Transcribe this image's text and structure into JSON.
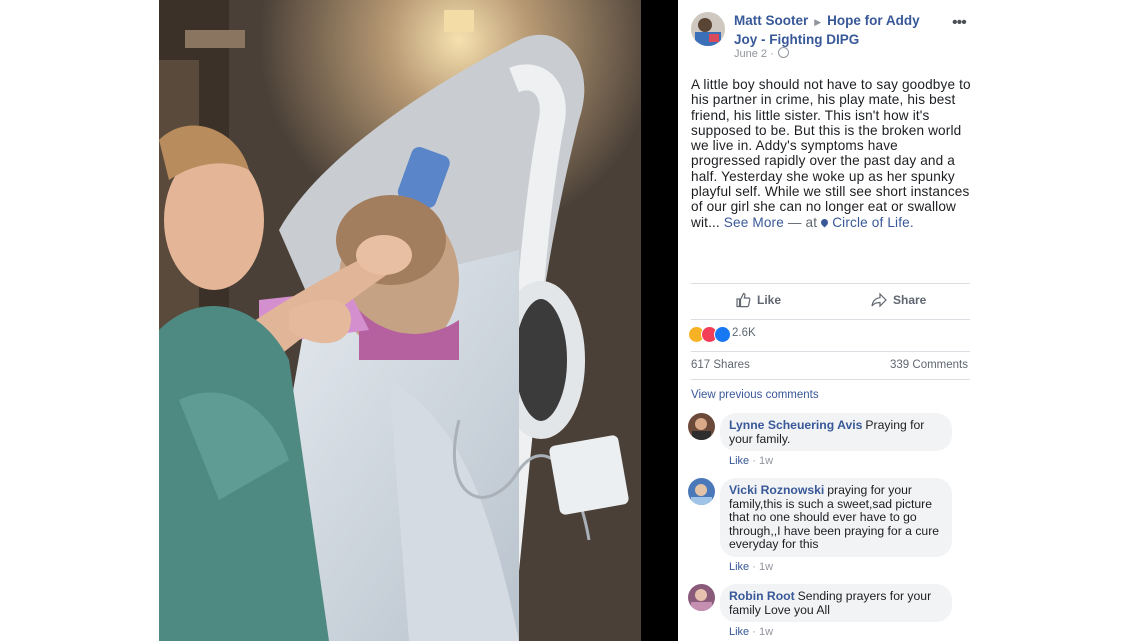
{
  "post": {
    "author": "Matt Sooter",
    "group": "Hope for Addy Joy - Fighting DIPG",
    "date": "June 2",
    "text": "A little boy should not have to say goodbye to his partner in crime, his play mate, his best friend, his little sister. This isn't how it's supposed to be. But this is the broken world we live in. Addy's symptoms have progressed rapidly over the past day and a half. Yesterday she woke up as her spunky playful self. While we still see short instances of our girl she can no longer eat or swallow wit...",
    "see_more": "See More",
    "at_separator": "— at",
    "place": "Circle of Life."
  },
  "actions": {
    "like_label": "Like",
    "share_label": "Share"
  },
  "stats": {
    "reactions": "2.6K",
    "reaction_icons": [
      "sad-icon",
      "love-icon",
      "like-icon"
    ],
    "shares": "617 Shares",
    "comments": "339 Comments"
  },
  "view_previous": "View previous comments",
  "comments": [
    {
      "name": "Lynne Scheuering Avis",
      "text": "Praying for your family.",
      "like": "Like",
      "time": "1w"
    },
    {
      "name": "Vicki Roznowski",
      "text": "praying for your family,this is such a sweet,sad picture that no one should ever have to go through,,I have been praying for a cure everyday for this",
      "like": "Like",
      "time": "1w"
    },
    {
      "name": "Robin Root",
      "text": "Sending prayers for your family Love you All",
      "like": "Like",
      "time": "1w"
    }
  ],
  "colors": {
    "link": "#385898",
    "meta": "#90949c",
    "bubble": "#f2f3f5",
    "like_blue": "#1877f2",
    "love_red": "#f33e58",
    "sad_yellow": "#f7b125"
  }
}
